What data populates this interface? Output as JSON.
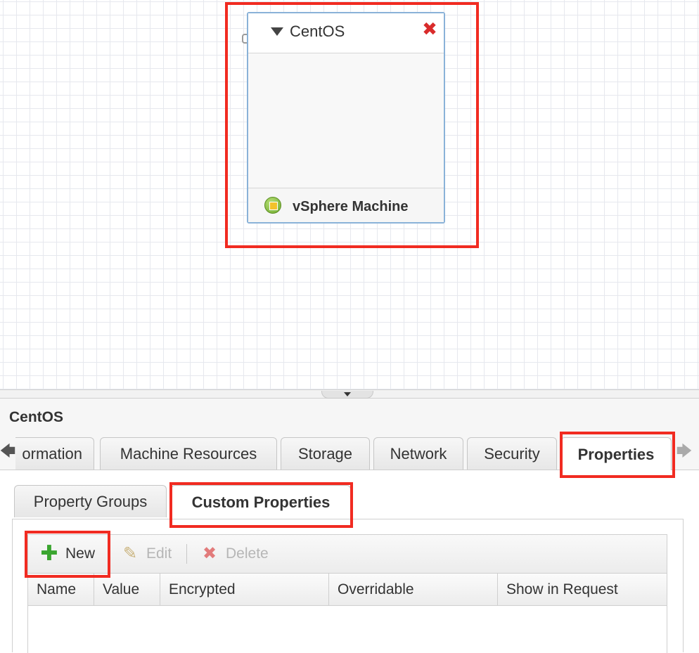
{
  "canvas": {
    "node": {
      "title": "CentOS",
      "close_icon": "close-icon",
      "component_type": "vSphere Machine",
      "component_icon": "vsphere-machine-icon"
    }
  },
  "panel": {
    "title": "CentOS",
    "tabs": [
      {
        "label": "ormation",
        "active": false
      },
      {
        "label": "Machine Resources",
        "active": false
      },
      {
        "label": "Storage",
        "active": false
      },
      {
        "label": "Network",
        "active": false
      },
      {
        "label": "Security",
        "active": false
      },
      {
        "label": "Properties",
        "active": true
      }
    ],
    "subtabs": [
      {
        "label": "Property Groups",
        "active": false
      },
      {
        "label": "Custom Properties",
        "active": true
      }
    ],
    "toolbar": {
      "new_label": "New",
      "edit_label": "Edit",
      "delete_label": "Delete"
    },
    "grid": {
      "columns": [
        "Name",
        "Value",
        "Encrypted",
        "Overridable",
        "Show in Request"
      ]
    }
  },
  "colors": {
    "highlight": "#f12b21",
    "node_border": "#8ab2d8",
    "add_green": "#3aa52f",
    "close_red": "#d92b2b"
  }
}
